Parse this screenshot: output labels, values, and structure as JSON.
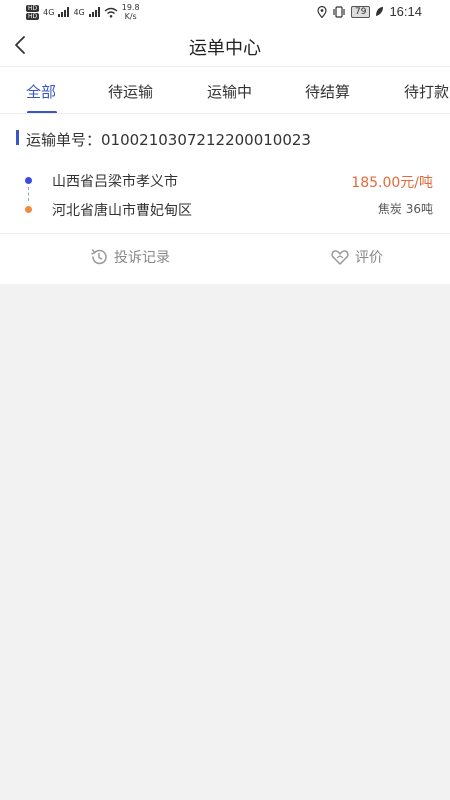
{
  "status_bar": {
    "hd_top": "HD",
    "hd_bottom": "HD",
    "net1": "4G",
    "net2": "4G",
    "speed_value": "19.8",
    "speed_unit": "K/s",
    "battery": "79",
    "time": "16:14"
  },
  "header": {
    "title": "运单中心"
  },
  "tabs": [
    {
      "label": "全部",
      "active": true
    },
    {
      "label": "待运输",
      "active": false
    },
    {
      "label": "运输中",
      "active": false
    },
    {
      "label": "待结算",
      "active": false
    },
    {
      "label": "待打款",
      "active": false
    }
  ],
  "order": {
    "number_text": "运输单号：0100210307212200010023",
    "from": "山西省吕梁市孝义市",
    "to": "河北省唐山市曹妃甸区",
    "price": "185.00元/吨",
    "goods": "焦炭  36吨"
  },
  "actions": {
    "complaint": "投诉记录",
    "review": "评价"
  },
  "colors": {
    "accent": "#3a56c8",
    "price": "#e46a3b",
    "origin_dot": "#3f48e0",
    "dest_dot": "#f08a3c"
  }
}
